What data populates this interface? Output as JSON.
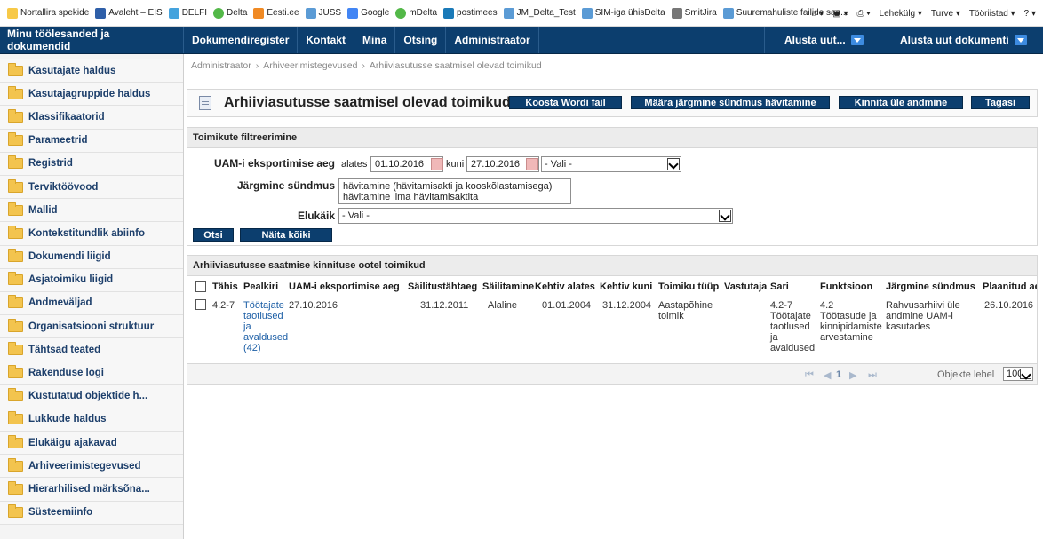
{
  "favorites": [
    {
      "label": "Nortallira spekide",
      "icon": "star-icon"
    },
    {
      "label": "Avaleht – EIS",
      "icon": "site-icon"
    },
    {
      "label": "DELFI",
      "icon": "delfi-icon"
    },
    {
      "label": "Delta",
      "icon": "delta-icon"
    },
    {
      "label": "Eesti.ee",
      "icon": "eesti-icon"
    },
    {
      "label": "JUSS",
      "icon": "page-icon"
    },
    {
      "label": "Google",
      "icon": "google-icon"
    },
    {
      "label": "mDelta",
      "icon": "delta-icon"
    },
    {
      "label": "postimees",
      "icon": "postimees-icon"
    },
    {
      "label": "JM_Delta_Test",
      "icon": "page-icon"
    },
    {
      "label": "SIM-iga ühisDelta",
      "icon": "page-icon"
    },
    {
      "label": "SmitJira",
      "icon": "jira-icon"
    },
    {
      "label": "Suuremahuliste failide saa...",
      "icon": "page-icon"
    }
  ],
  "browser_tools": {
    "page": "Lehekülg ▾",
    "safety": "Turve ▾",
    "tools": "Tööriistad ▾"
  },
  "nav": {
    "home": "Minu töölesanded ja dokumendid",
    "items": [
      "Dokumendiregister",
      "Kontakt",
      "Mina",
      "Otsing",
      "Administraator"
    ],
    "start_new": "Alusta uut...",
    "start_new_doc": "Alusta uut dokumenti"
  },
  "sidebar": {
    "items": [
      "Kasutajate haldus",
      "Kasutajagruppide haldus",
      "Klassifikaatorid",
      "Parameetrid",
      "Registrid",
      "Terviktöövood",
      "Mallid",
      "Kontekstitundlik abiinfo",
      "Dokumendi liigid",
      "Asjatoimiku liigid",
      "Andmeväljad",
      "Organisatsiooni struktuur",
      "Tähtsad teated",
      "Rakenduse logi",
      "Kustutatud objektide h...",
      "Lukkude haldus",
      "Elukäigu ajakavad",
      "Arhiveerimistegevused",
      "Hierarhilised märksõna...",
      "Süsteemiinfo"
    ]
  },
  "breadcrumb": [
    "Administraator",
    "Arhiveerimistegevused",
    "Arhiivi­asutusse saatmisel olevad toimikud"
  ],
  "page": {
    "title": "Arhiivi­asutusse saatmisel olevad toimikud",
    "buttons": {
      "word": "Koosta Wordi fail",
      "next_event": "Määra järgmine sündmus hävitamine",
      "confirm": "Kinnita üle andmine",
      "back": "Tagasi"
    }
  },
  "filter": {
    "heading": "Toimikute filtreerimine",
    "export_label": "UAM-i eksportimise aeg",
    "from_label": "alates",
    "from_value": "01.10.2016",
    "to_label": "kuni",
    "to_value": "27.10.2016",
    "period_value": "- Vali -",
    "next_event_label": "Järgmine sündmus",
    "next_event_options": [
      "hävitamine (hävitamisakti ja kooskõlastamisega)",
      "hävitamine ilma hävitamisaktita"
    ],
    "lifecycle_label": "Elukäik",
    "lifecycle_value": "- Vali -",
    "search_btn": "Otsi",
    "show_all_btn": "Näita kõiki"
  },
  "results": {
    "heading": "Arhiivi­asutusse saatmise kinnituse ootel toimikud",
    "columns": [
      "Tähis",
      "Pealkiri",
      "UAM-i eksportimise aeg",
      "Säilitustähtaeg",
      "Säilitamine",
      "Kehtiv alates",
      "Kehtiv kuni",
      "Toimiku tüüp",
      "Vastutaja",
      "Sari",
      "Funktsioon",
      "Järgmine sündmus",
      "Plaanitud aeg"
    ],
    "rows": [
      {
        "tahis": "4.2-7",
        "pealkiri": [
          "Töötajate",
          "taotlused",
          "ja",
          "avaldused",
          "(42)"
        ],
        "eksport": "27.10.2016",
        "sailitustahtaeg": "31.12.2011",
        "sailitamine": "Alaline",
        "alates": "01.01.2004",
        "kuni": "31.12.2004",
        "tyyp": [
          "Aastapõhine",
          "toimik"
        ],
        "vastutaja": "",
        "sari": [
          "4.2-7",
          "Töötajate",
          "taotlused",
          "ja",
          "avaldused"
        ],
        "funktsioon": [
          "4.2",
          "Töötasude ja",
          "kinnipidamiste",
          "arvestamine"
        ],
        "jargmine": [
          "Rahvusarhiivi üle",
          "andmine UAM-i",
          "kasutades"
        ],
        "plaanitud": "26.10.2016"
      }
    ],
    "pager": {
      "current": "1",
      "per_page_label": "Objekte lehel",
      "per_page_value": "100"
    }
  }
}
